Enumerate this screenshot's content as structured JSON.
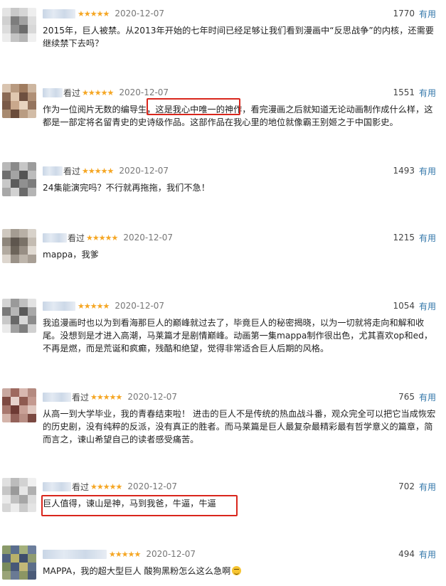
{
  "comments": [
    {
      "watched": "",
      "stars": "★★★★★",
      "date": "2020-12-07",
      "votes": "1770",
      "useful_label": "有用",
      "text": "2015年，巨人被禁。从2013年开始的七年时间已经足够让我们看到漫画中“反思战争”的内核，还需要继续禁下去吗？"
    },
    {
      "watched": "看过",
      "stars": "★★★★★",
      "date": "2020-12-07",
      "votes": "1551",
      "useful_label": "有用",
      "text": "作为一位阅片无数的编导生，这是我心中唯一的神作，看完漫画之后就知道无论动画制作成什么样，这都是一部定将名留青史的史诗级作品。这部作品在我心里的地位就像霸王别姬之于中国影史。"
    },
    {
      "watched": "看过",
      "stars": "★★★★★",
      "date": "2020-12-07",
      "votes": "1493",
      "useful_label": "有用",
      "text": "24集能演完吗？不行就再拖拖，我们不急！"
    },
    {
      "watched": "看过",
      "stars": "★★★★★",
      "date": "2020-12-07",
      "votes": "1215",
      "useful_label": "有用",
      "text": "mappa，我爹"
    },
    {
      "watched": "",
      "stars": "★★★★★",
      "date": "2020-12-07",
      "votes": "1054",
      "useful_label": "有用",
      "text": "我追漫画时也以为到看海那巨人的巅峰就过去了，毕竟巨人的秘密揭晓，以为一切就将走向和解和收尾。没想到是才进入高潮，马莱篇才是剧情巅峰。动画第一集mappa制作很出色，尤其喜欢op和ed，不再是燃，而是荒诞和疯癫，残酷和绝望，觉得非常适合巨人后期的风格。"
    },
    {
      "watched": "看过",
      "stars": "★★★★★",
      "date": "2020-12-07",
      "votes": "765",
      "useful_label": "有用",
      "text": "从高一到大学毕业，我的青春结束啦！ 进击的巨人不是传统的热血战斗番，观众完全可以把它当成恢宏的历史剧，没有纯粹的反派，没有真正的胜者。而马莱篇是巨人最复杂最精彩最有哲学意义的篇章，简而言之，谏山希望自己的读者感受痛苦。"
    },
    {
      "watched": "看过",
      "stars": "★★★★★",
      "date": "2020-12-07",
      "votes": "702",
      "useful_label": "有用",
      "text": "巨人值得，谏山是神，马到我爸，牛逼，牛逼"
    },
    {
      "watched": "",
      "stars": "★★★★★",
      "date": "2020-12-07",
      "votes": "494",
      "useful_label": "有用",
      "text": "MAPPA，我的超大型巨人 酸狗黑粉怎么这么急啊"
    }
  ]
}
